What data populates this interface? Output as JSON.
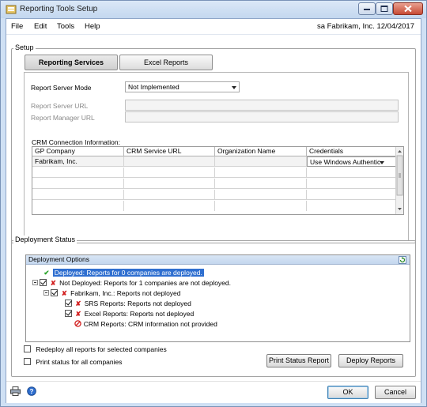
{
  "window": {
    "title": "Reporting Tools Setup"
  },
  "menu": {
    "items": [
      "File",
      "Edit",
      "Tools",
      "Help"
    ],
    "context": "sa  Fabrikam, Inc.  12/04/2017"
  },
  "setup": {
    "label": "Setup",
    "tabs": [
      "Reporting Services",
      "Excel Reports"
    ],
    "active_tab": "Reporting Services",
    "report_server_mode": {
      "label": "Report Server Mode",
      "value": "Not Implemented"
    },
    "report_server_url": {
      "label": "Report Server URL",
      "value": ""
    },
    "report_manager_url": {
      "label": "Report Manager URL",
      "value": ""
    },
    "crm": {
      "label": "CRM Connection Information:",
      "columns": [
        "GP Company",
        "CRM Service URL",
        "Organization Name",
        "Credentials"
      ],
      "rows": [
        {
          "gp_company": "Fabrikam, Inc.",
          "crm_service_url": "",
          "organization_name": "",
          "credentials": "Use Windows Authentic"
        }
      ]
    }
  },
  "deployment": {
    "label": "Deployment Status",
    "header": "Deployment Options",
    "tree": {
      "deployed": "Deployed: Reports for 0 companies are deployed.",
      "not_deployed": "Not Deployed: Reports for 1 companies are not deployed.",
      "company": "Fabrikam, Inc.: Reports not deployed",
      "srs": "SRS Reports: Reports not deployed",
      "excel": "Excel Reports: Reports not deployed",
      "crm": "CRM Reports: CRM information not provided"
    },
    "redeploy_label": "Redeploy all reports for selected companies",
    "print_status_label": "Print status for all companies",
    "print_button": "Print Status Report",
    "deploy_button": "Deploy Reports"
  },
  "footer": {
    "ok": "OK",
    "cancel": "Cancel"
  },
  "colors": {
    "selection": "#2f6fd0",
    "check_green": "#2aa32a",
    "error_red": "#d22020"
  }
}
